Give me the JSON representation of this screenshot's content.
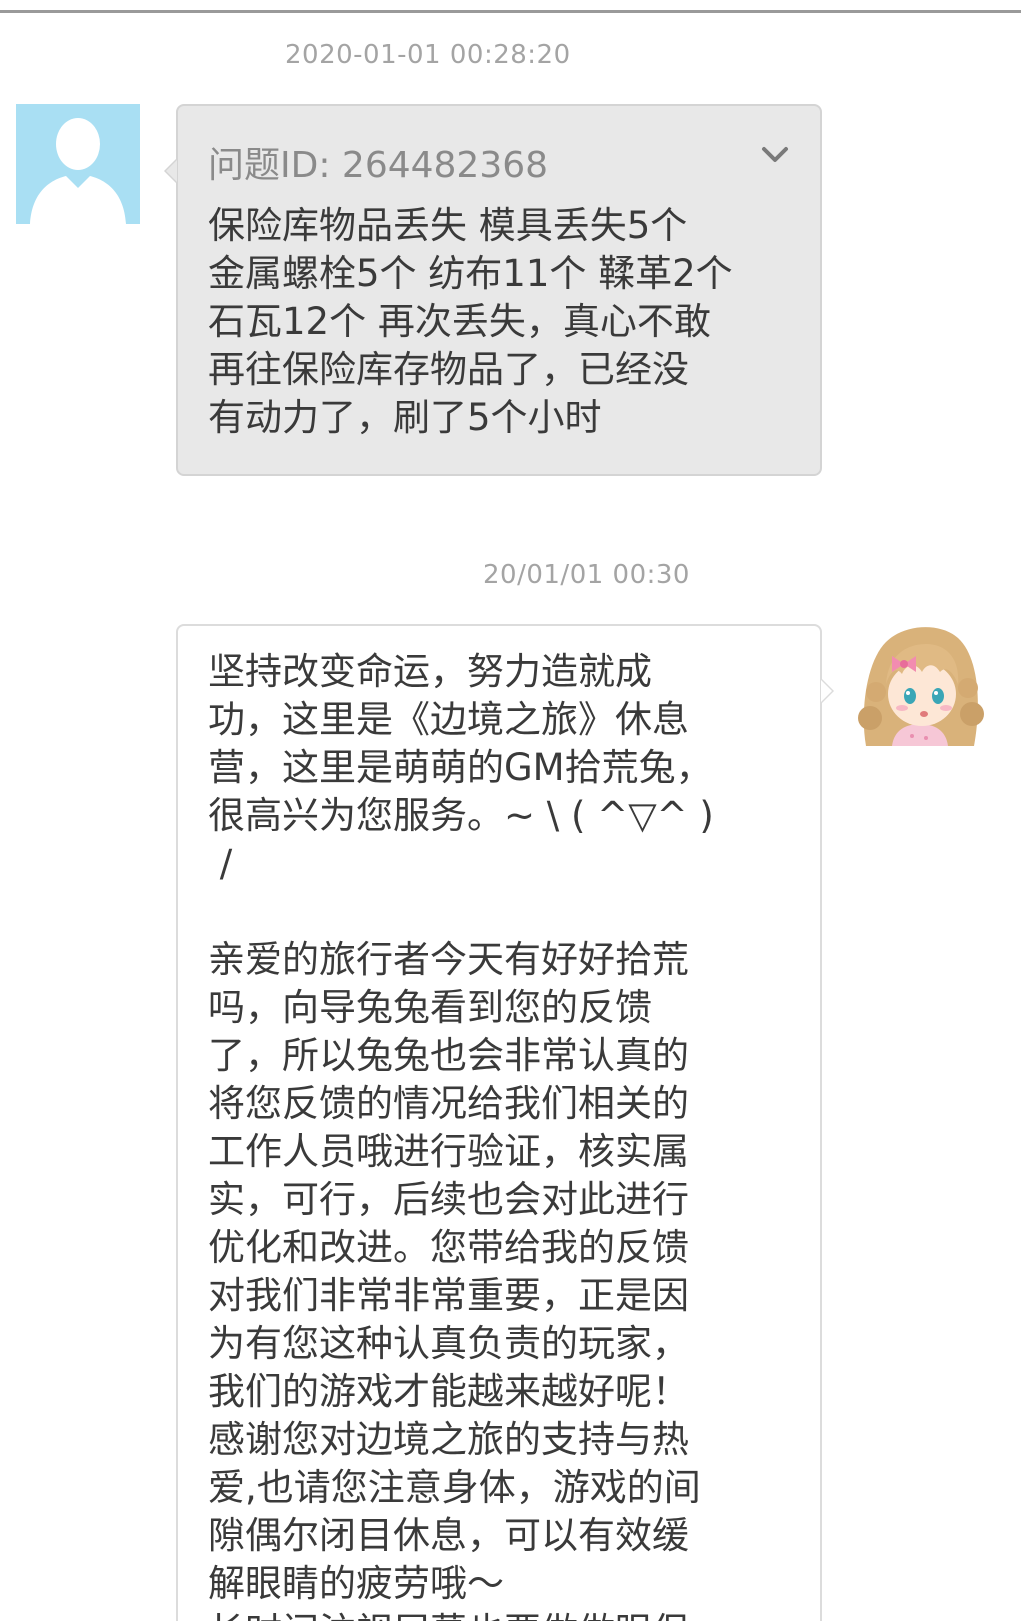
{
  "conversation": {
    "messages": [
      {
        "timestamp": "2020-01-01 00:28:20",
        "sender": "user",
        "issue_id": "问题ID: 264482368",
        "text": "保险库物品丢失 模具丢失5个\n金属螺栓5个 纺布11个 鞣革2个\n石瓦12个 再次丢失，真心不敢\n再往保险库存物品了，已经没\n有动力了，刷了5个小时"
      },
      {
        "timestamp": "20/01/01 00:30",
        "sender": "gm",
        "text": "坚持改变命运，努力造就成\n功，这里是《边境之旅》休息\n营，这里是萌萌的GM拾荒兔，\n很高兴为您服务。~ \\ ( ^▽^ )\n /\n\n亲爱的旅行者今天有好好拾荒\n吗，向导兔兔看到您的反馈\n了，所以兔兔也会非常认真的\n将您反馈的情况给我们相关的\n工作人员哦进行验证，核实属\n实，可行，后续也会对此进行\n优化和改进。您带给我的反馈\n对我们非常非常重要，正是因\n为有您这种认真负责的玩家，\n我们的游戏才能越来越好呢！\n感谢您对边境之旅的支持与热\n爱,也请您注意身体，游戏的间\n隙偶尔闭目休息，可以有效缓\n解眼睛的疲劳哦～\n长时间注视屏幕也要做做眼保"
      }
    ]
  },
  "icons": {
    "user_avatar": "default-person-avatar-icon",
    "gm_avatar": "anime-girl-avatar",
    "expand": "chevron-down-icon"
  },
  "colors": {
    "user_avatar_bg": "#a9dff3",
    "user_bubble_bg": "#e8e8e8",
    "gm_bubble_bg": "#ffffff",
    "timestamp": "#a4a4a4"
  }
}
